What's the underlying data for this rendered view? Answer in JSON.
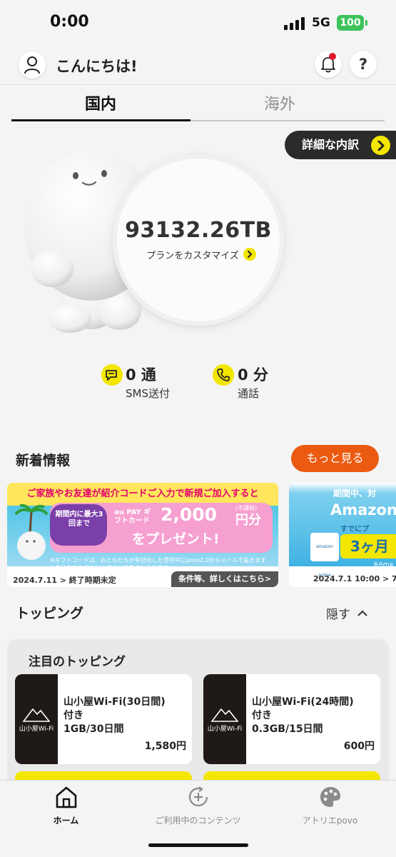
{
  "status_bar": {
    "time": "0:00",
    "network": "5G",
    "battery": "100",
    "battery_color": "#3cc35a"
  },
  "header": {
    "greeting": "こんにちは!",
    "help_label": "?",
    "icons": [
      "user-icon",
      "bell-icon",
      "help-icon"
    ],
    "notification_dot_color": "#e0182d"
  },
  "tabs": [
    {
      "label": "国内",
      "active": true
    },
    {
      "label": "海外",
      "active": false
    }
  ],
  "usage": {
    "detail_label": "詳細な内訳",
    "data_remaining": "93132.26TB",
    "customize_label": "プランをカスタマイズ",
    "sms": {
      "value": "0 通",
      "label": "SMS送付"
    },
    "call": {
      "value": "0 分",
      "label": "通話"
    }
  },
  "news": {
    "title": "新着情報",
    "more_label": "もっと見る",
    "banners": [
      {
        "headline": "ご家族やお友達が紹介コードご入力で新規ご加入すると",
        "limit_text": "期間内に最大3回まで",
        "brand": "au PAY ギフトカード",
        "amount": "2,000",
        "yen": "円分",
        "tax": "(不課税)",
        "present": "をプレゼント!",
        "note1": "※ギフトコードは、おともだちが有効化した翌月中にpovo2.0からメールで届きます",
        "note2": "※自分自身を紹介した場合は特典の対象外です",
        "date": "2024.7.11 > 終了時期未定",
        "terms": "条件等、詳しくはこちら>"
      },
      {
        "period": "期間中、対",
        "brand": "Amazon",
        "already": "すでにプ",
        "months": "3ヶ月",
        "prime_label": "amazon prime",
        "note": "※Ama",
        "date": "2024.7.1 10:00 > 7"
      }
    ]
  },
  "topping": {
    "title": "トッピング",
    "hide_label": "隠す",
    "subtitle": "注目のトッピング",
    "items": [
      {
        "name": "山小屋Wi-Fi(30日間)付き 1GB/30日間",
        "line1": "山小屋Wi-Fi(30日間)",
        "line2": "付き",
        "line3": "1GB/30日間",
        "price": "1,580円",
        "brand": "山小屋Wi-Fi"
      },
      {
        "name": "山小屋Wi-Fi(24時間)付き 0.3GB/15日間",
        "line1": "山小屋Wi-Fi(24時間)",
        "line2": "付き",
        "line3": "0.3GB/15日間",
        "price": "600円",
        "brand": "山小屋Wi-Fi"
      }
    ]
  },
  "bottom_nav": [
    {
      "label": "ホーム",
      "icon": "home-icon",
      "active": true
    },
    {
      "label": "ご利用中のコンテンツ",
      "icon": "refresh-add-icon",
      "active": false
    },
    {
      "label": "アトリエpovo",
      "icon": "palette-icon",
      "active": false
    }
  ],
  "colors": {
    "accent_yellow": "#f3e600",
    "more_button": "#ea5a10",
    "dark_pill": "#2b2b2b"
  }
}
